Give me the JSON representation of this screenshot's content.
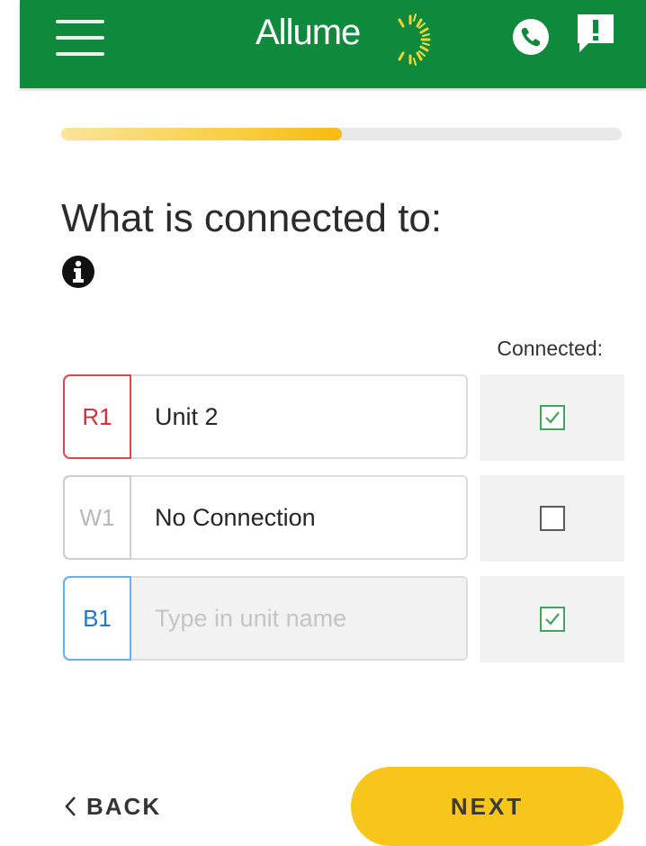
{
  "app": {
    "brand": "Allume",
    "colors": {
      "header": "#0f8a3d",
      "accent": "#f8c51b",
      "red": "#d62f3a",
      "blue": "#1f78c8",
      "check": "#43a55d"
    }
  },
  "header": {
    "menu_icon": "hamburger-menu-icon",
    "logo_text": "Allume",
    "call_icon": "phone-icon",
    "feedback_icon": "feedback-icon"
  },
  "progress": {
    "fraction": 0.5
  },
  "question": {
    "title": "What is connected to:",
    "info_icon": "info-icon"
  },
  "connections": {
    "column_header": "Connected:",
    "rows": [
      {
        "terminal": "R1",
        "value": "Unit 2",
        "placeholder": "",
        "connected": true
      },
      {
        "terminal": "W1",
        "value": "No Connection",
        "placeholder": "",
        "connected": false
      },
      {
        "terminal": "B1",
        "value": "",
        "placeholder": "Type in unit name",
        "connected": true
      }
    ]
  },
  "footer": {
    "back_label": "BACK",
    "next_label": "NEXT"
  }
}
